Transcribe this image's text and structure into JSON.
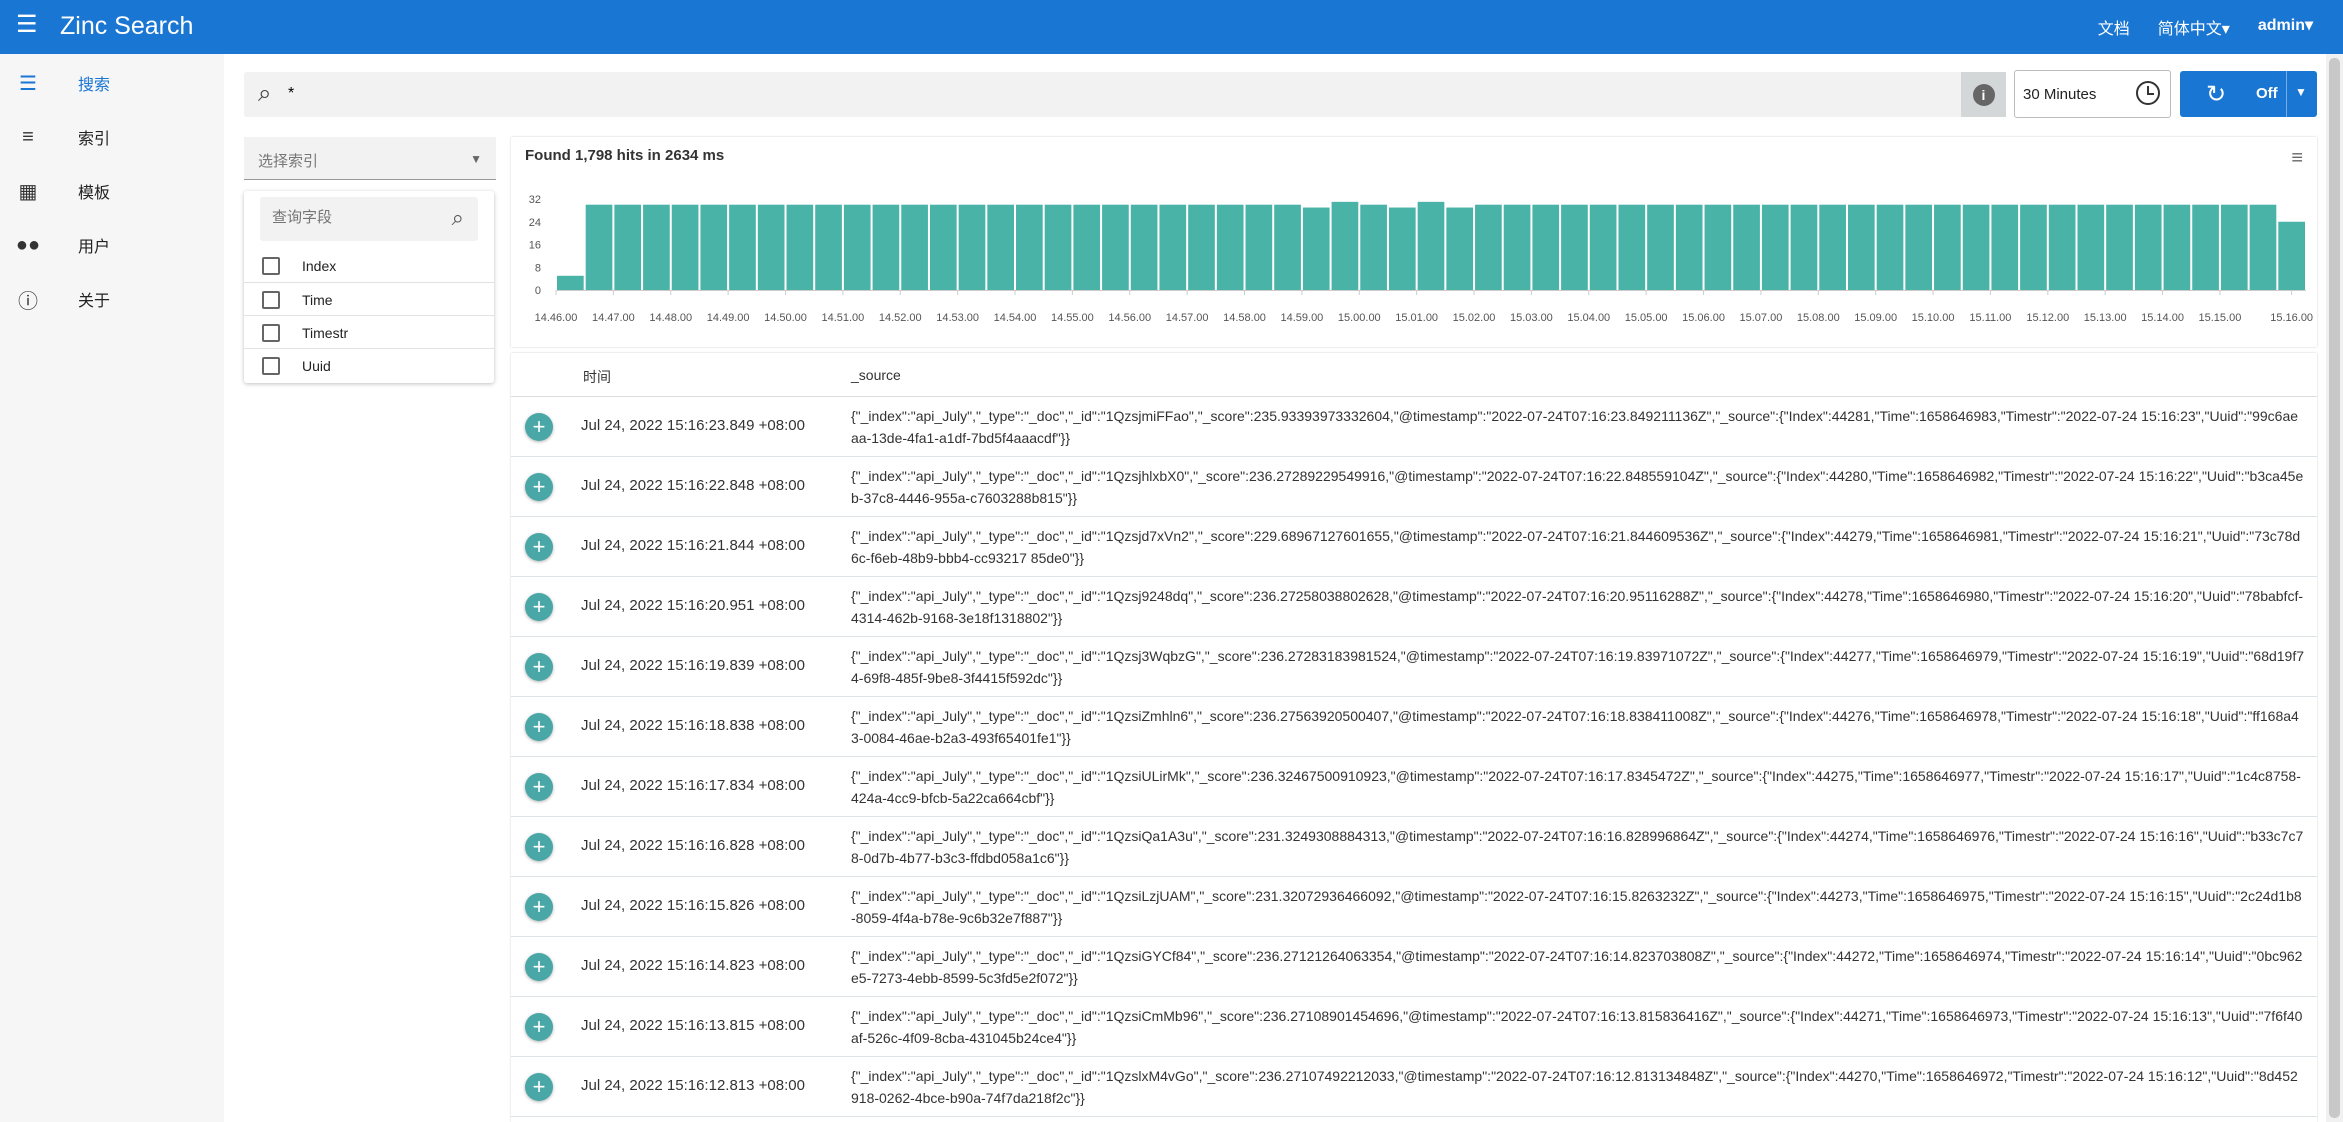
{
  "header": {
    "title": "Zinc Search",
    "docs": "文档",
    "language": "简体中文▾",
    "user": "admin▾"
  },
  "sidebar": {
    "items": [
      {
        "label": "搜索",
        "icon": "search-list-icon",
        "glyph": "☰"
      },
      {
        "label": "索引",
        "icon": "list-icon",
        "glyph": "≡"
      },
      {
        "label": "模板",
        "icon": "grid-icon",
        "glyph": "▦"
      },
      {
        "label": "用户",
        "icon": "people-icon",
        "glyph": "👥"
      },
      {
        "label": "关于",
        "icon": "info-icon",
        "glyph": "ℹ"
      }
    ]
  },
  "search": {
    "value": "*",
    "placeholder": ""
  },
  "time_range": "30 Minutes",
  "refresh": {
    "label": "Off"
  },
  "index_select": {
    "placeholder": "选择索引"
  },
  "fields": {
    "search_placeholder": "查询字段",
    "items": [
      "Index",
      "Time",
      "Timestr",
      "Uuid"
    ]
  },
  "results": {
    "summary": "Found 1,798 hits in 2634 ms"
  },
  "colors": {
    "primary": "#1976d2",
    "bar": "#4ab3a8"
  },
  "chart_data": {
    "type": "bar",
    "title": "Found 1,798 hits in 2634 ms",
    "ylim": [
      0,
      32
    ],
    "yticks": [
      "0",
      "8",
      "16",
      "24",
      "32"
    ],
    "tick_labels": [
      "14.46.00",
      "14.47.00",
      "14.48.00",
      "14.49.00",
      "14.50.00",
      "14.51.00",
      "14.52.00",
      "14.53.00",
      "14.54.00",
      "14.55.00",
      "14.56.00",
      "14.57.00",
      "14.58.00",
      "14.59.00",
      "15.00.00",
      "15.01.00",
      "15.02.00",
      "15.03.00",
      "15.04.00",
      "15.05.00",
      "15.06.00",
      "15.07.00",
      "15.08.00",
      "15.09.00",
      "15.10.00",
      "15.11.00",
      "15.12.00",
      "15.13.00",
      "15.14.00",
      "15.15.00",
      "15.16.00"
    ],
    "values": [
      5,
      30,
      30,
      30,
      30,
      30,
      30,
      30,
      30,
      30,
      30,
      30,
      30,
      30,
      30,
      30,
      30,
      30,
      30,
      30,
      30,
      30,
      30,
      30,
      30,
      30,
      29,
      31,
      30,
      29,
      31,
      29,
      30,
      30,
      30,
      30,
      30,
      30,
      30,
      30,
      30,
      30,
      30,
      30,
      30,
      30,
      30,
      30,
      30,
      30,
      30,
      30,
      30,
      30,
      30,
      30,
      30,
      30,
      30,
      30,
      24
    ]
  },
  "table": {
    "headers": {
      "time": "时间",
      "source": "_source"
    },
    "rows": [
      {
        "time": "Jul 24, 2022 15:16:23.849 +08:00",
        "source": "{\"_index\":\"api_July\",\"_type\":\"_doc\",\"_id\":\"1QzsjmiFFao\",\"_score\":235.93393973332604,\"@timestamp\":\"2022-07-24T07:16:23.849211136Z\",\"_source\":{\"Index\":44281,\"Time\":1658646983,\"Timestr\":\"2022-07-24 15:16:23\",\"Uuid\":\"99c6aeaa-13de-4fa1-a1df-7bd5f4aaacdf\"}}"
      },
      {
        "time": "Jul 24, 2022 15:16:22.848 +08:00",
        "source": "{\"_index\":\"api_July\",\"_type\":\"_doc\",\"_id\":\"1QzsjhlxbX0\",\"_score\":236.27289229549916,\"@timestamp\":\"2022-07-24T07:16:22.848559104Z\",\"_source\":{\"Index\":44280,\"Time\":1658646982,\"Timestr\":\"2022-07-24 15:16:22\",\"Uuid\":\"b3ca45eb-37c8-4446-955a-c7603288b815\"}}"
      },
      {
        "time": "Jul 24, 2022 15:16:21.844 +08:00",
        "source": "{\"_index\":\"api_July\",\"_type\":\"_doc\",\"_id\":\"1Qzsjd7xVn2\",\"_score\":229.68967127601655,\"@timestamp\":\"2022-07-24T07:16:21.844609536Z\",\"_source\":{\"Index\":44279,\"Time\":1658646981,\"Timestr\":\"2022-07-24 15:16:21\",\"Uuid\":\"73c78d6c-f6eb-48b9-bbb4-cc93217 85de0\"}}"
      },
      {
        "time": "Jul 24, 2022 15:16:20.951 +08:00",
        "source": "{\"_index\":\"api_July\",\"_type\":\"_doc\",\"_id\":\"1Qzsj9248dq\",\"_score\":236.27258038802628,\"@timestamp\":\"2022-07-24T07:16:20.95116288Z\",\"_source\":{\"Index\":44278,\"Time\":1658646980,\"Timestr\":\"2022-07-24 15:16:20\",\"Uuid\":\"78babfcf-4314-462b-9168-3e18f1318802\"}}"
      },
      {
        "time": "Jul 24, 2022 15:16:19.839 +08:00",
        "source": "{\"_index\":\"api_July\",\"_type\":\"_doc\",\"_id\":\"1Qzsj3WqbzG\",\"_score\":236.27283183981524,\"@timestamp\":\"2022-07-24T07:16:19.83971072Z\",\"_source\":{\"Index\":44277,\"Time\":1658646979,\"Timestr\":\"2022-07-24 15:16:19\",\"Uuid\":\"68d19f74-69f8-485f-9be8-3f4415f592dc\"}}"
      },
      {
        "time": "Jul 24, 2022 15:16:18.838 +08:00",
        "source": "{\"_index\":\"api_July\",\"_type\":\"_doc\",\"_id\":\"1QzsiZmhln6\",\"_score\":236.27563920500407,\"@timestamp\":\"2022-07-24T07:16:18.838411008Z\",\"_source\":{\"Index\":44276,\"Time\":1658646978,\"Timestr\":\"2022-07-24 15:16:18\",\"Uuid\":\"ff168a43-0084-46ae-b2a3-493f65401fe1\"}}"
      },
      {
        "time": "Jul 24, 2022 15:16:17.834 +08:00",
        "source": "{\"_index\":\"api_July\",\"_type\":\"_doc\",\"_id\":\"1QzsiULirMk\",\"_score\":236.32467500910923,\"@timestamp\":\"2022-07-24T07:16:17.8345472Z\",\"_source\":{\"Index\":44275,\"Time\":1658646977,\"Timestr\":\"2022-07-24 15:16:17\",\"Uuid\":\"1c4c8758-424a-4cc9-bfcb-5a22ca664cbf\"}}"
      },
      {
        "time": "Jul 24, 2022 15:16:16.828 +08:00",
        "source": "{\"_index\":\"api_July\",\"_type\":\"_doc\",\"_id\":\"1QzsiQa1A3u\",\"_score\":231.3249308884313,\"@timestamp\":\"2022-07-24T07:16:16.828996864Z\",\"_source\":{\"Index\":44274,\"Time\":1658646976,\"Timestr\":\"2022-07-24 15:16:16\",\"Uuid\":\"b33c7c78-0d7b-4b77-b3c3-ffdbd058a1c6\"}}"
      },
      {
        "time": "Jul 24, 2022 15:16:15.826 +08:00",
        "source": "{\"_index\":\"api_July\",\"_type\":\"_doc\",\"_id\":\"1QzsiLzjUAM\",\"_score\":231.32072936466092,\"@timestamp\":\"2022-07-24T07:16:15.8263232Z\",\"_source\":{\"Index\":44273,\"Time\":1658646975,\"Timestr\":\"2022-07-24 15:16:15\",\"Uuid\":\"2c24d1b8-8059-4f4a-b78e-9c6b32e7f887\"}}"
      },
      {
        "time": "Jul 24, 2022 15:16:14.823 +08:00",
        "source": "{\"_index\":\"api_July\",\"_type\":\"_doc\",\"_id\":\"1QzsiGYCf84\",\"_score\":236.27121264063354,\"@timestamp\":\"2022-07-24T07:16:14.823703808Z\",\"_source\":{\"Index\":44272,\"Time\":1658646974,\"Timestr\":\"2022-07-24 15:16:14\",\"Uuid\":\"0bc962e5-7273-4ebb-8599-5c3fd5e2f072\"}}"
      },
      {
        "time": "Jul 24, 2022 15:16:13.815 +08:00",
        "source": "{\"_index\":\"api_July\",\"_type\":\"_doc\",\"_id\":\"1QzsiCmMb96\",\"_score\":236.27108901454696,\"@timestamp\":\"2022-07-24T07:16:13.815836416Z\",\"_source\":{\"Index\":44271,\"Time\":1658646973,\"Timestr\":\"2022-07-24 15:16:13\",\"Uuid\":\"7f6f40af-526c-4f09-8cba-431045b24ce4\"}}"
      },
      {
        "time": "Jul 24, 2022 15:16:12.813 +08:00",
        "source": "{\"_index\":\"api_July\",\"_type\":\"_doc\",\"_id\":\"1QzslxM4vGo\",\"_score\":236.27107492212033,\"@timestamp\":\"2022-07-24T07:16:12.813134848Z\",\"_source\":{\"Index\":44270,\"Time\":1658646972,\"Timestr\":\"2022-07-24 15:16:12\",\"Uuid\":\"8d452918-0262-4bce-b90a-74f7da218f2c\"}}"
      }
    ]
  }
}
